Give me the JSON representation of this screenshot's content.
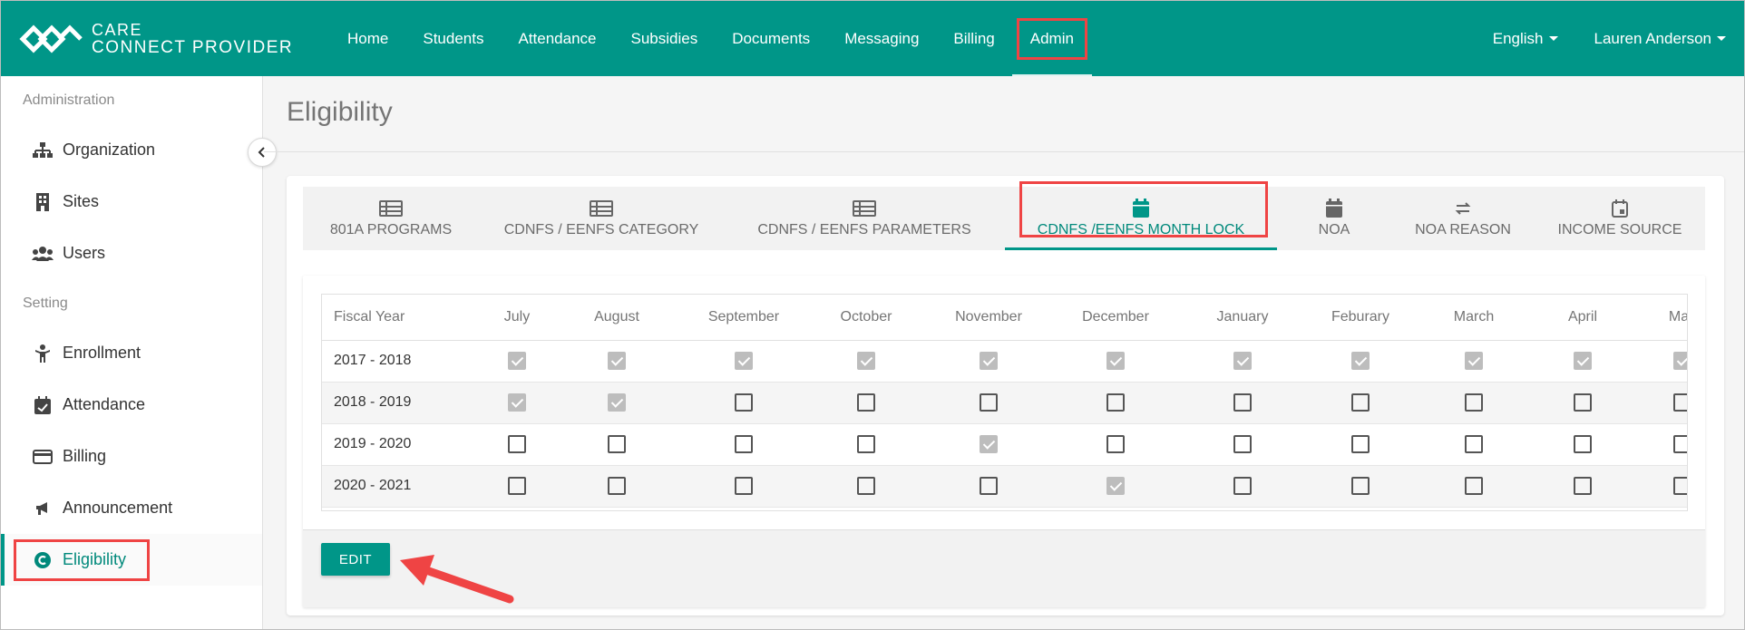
{
  "brand": {
    "line1": "CARE",
    "line2": "CONNECT PROVIDER"
  },
  "nav": {
    "items": [
      {
        "label": "Home"
      },
      {
        "label": "Students"
      },
      {
        "label": "Attendance"
      },
      {
        "label": "Subsidies"
      },
      {
        "label": "Documents"
      },
      {
        "label": "Messaging"
      },
      {
        "label": "Billing"
      },
      {
        "label": "Admin"
      }
    ],
    "language": "English",
    "user": "Lauren Anderson"
  },
  "sidebar": {
    "section1": "Administration",
    "admin_items": [
      {
        "label": "Organization",
        "icon": "sitemap-icon"
      },
      {
        "label": "Sites",
        "icon": "building-icon"
      },
      {
        "label": "Users",
        "icon": "users-icon"
      }
    ],
    "section2": "Setting",
    "setting_items": [
      {
        "label": "Enrollment",
        "icon": "child-icon"
      },
      {
        "label": "Attendance",
        "icon": "calendar-check-icon"
      },
      {
        "label": "Billing",
        "icon": "credit-card-icon"
      },
      {
        "label": "Announcement",
        "icon": "bullhorn-icon"
      },
      {
        "label": "Eligibility",
        "icon": "copyright-icon"
      }
    ]
  },
  "page": {
    "title": "Eligibility"
  },
  "tabs": [
    {
      "label": "801A PROGRAMS",
      "icon": "list-icon"
    },
    {
      "label": "CDNFS / EENFS CATEGORY",
      "icon": "list-icon"
    },
    {
      "label": "CDNFS / EENFS PARAMETERS",
      "icon": "list-icon"
    },
    {
      "label": "CDNFS /EENFS MONTH LOCK",
      "icon": "calendar-icon"
    },
    {
      "label": "NOA",
      "icon": "calendar-icon"
    },
    {
      "label": "NOA REASON",
      "icon": "exchange-icon"
    },
    {
      "label": "INCOME SOURCE",
      "icon": "calendar-icon"
    }
  ],
  "table": {
    "headers": [
      "Fiscal Year",
      "July",
      "August",
      "September",
      "October",
      "November",
      "December",
      "January",
      "Feburary",
      "March",
      "April",
      "May"
    ],
    "rows": [
      {
        "year": "2017 - 2018",
        "checks": [
          true,
          true,
          true,
          true,
          true,
          true,
          true,
          true,
          true,
          true,
          true
        ]
      },
      {
        "year": "2018 - 2019",
        "checks": [
          true,
          true,
          false,
          false,
          false,
          false,
          false,
          false,
          false,
          false,
          false
        ]
      },
      {
        "year": "2019 - 2020",
        "checks": [
          false,
          false,
          false,
          false,
          true,
          false,
          false,
          false,
          false,
          false,
          false
        ]
      },
      {
        "year": "2020 - 2021",
        "checks": [
          false,
          false,
          false,
          false,
          false,
          true,
          false,
          false,
          false,
          false,
          false
        ]
      }
    ]
  },
  "actions": {
    "edit_label": "EDIT"
  },
  "colors": {
    "primary": "#009688",
    "highlight": "#ef4444"
  }
}
